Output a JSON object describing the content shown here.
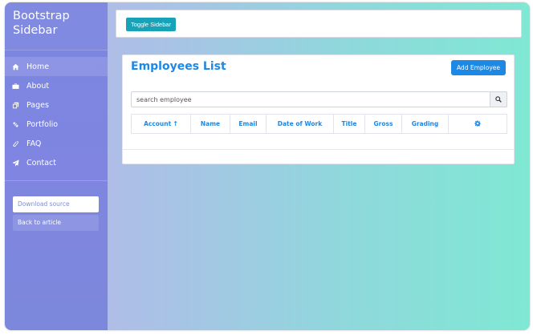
{
  "sidebar": {
    "brand_line1": "Bootstrap",
    "brand_line2": "Sidebar",
    "items": [
      {
        "label": "Home",
        "icon": "home-icon"
      },
      {
        "label": "About",
        "icon": "briefcase-icon"
      },
      {
        "label": "Pages",
        "icon": "copy-icon"
      },
      {
        "label": "Portfolio",
        "icon": "link-icon"
      },
      {
        "label": "FAQ",
        "icon": "paperclip-icon"
      },
      {
        "label": "Contact",
        "icon": "paper-plane-icon"
      }
    ],
    "download_label": "Download source",
    "back_label": "Back to article"
  },
  "topbar": {
    "toggle_label": "Toggle Sidebar"
  },
  "main": {
    "title": "Employees List",
    "add_label": "Add Employee",
    "search": {
      "placeholder": "search employee",
      "value": ""
    },
    "columns": [
      {
        "label": "Account",
        "sort": "asc"
      },
      {
        "label": "Name"
      },
      {
        "label": "Email"
      },
      {
        "label": "Date of Work"
      },
      {
        "label": "Title"
      },
      {
        "label": "Gross"
      },
      {
        "label": "Grading"
      },
      {
        "label": "",
        "icon": "gear-icon"
      }
    ]
  },
  "colors": {
    "accent": "#1e88e5",
    "toggle": "#17a2b8",
    "sidebar": "#7c86dd"
  }
}
